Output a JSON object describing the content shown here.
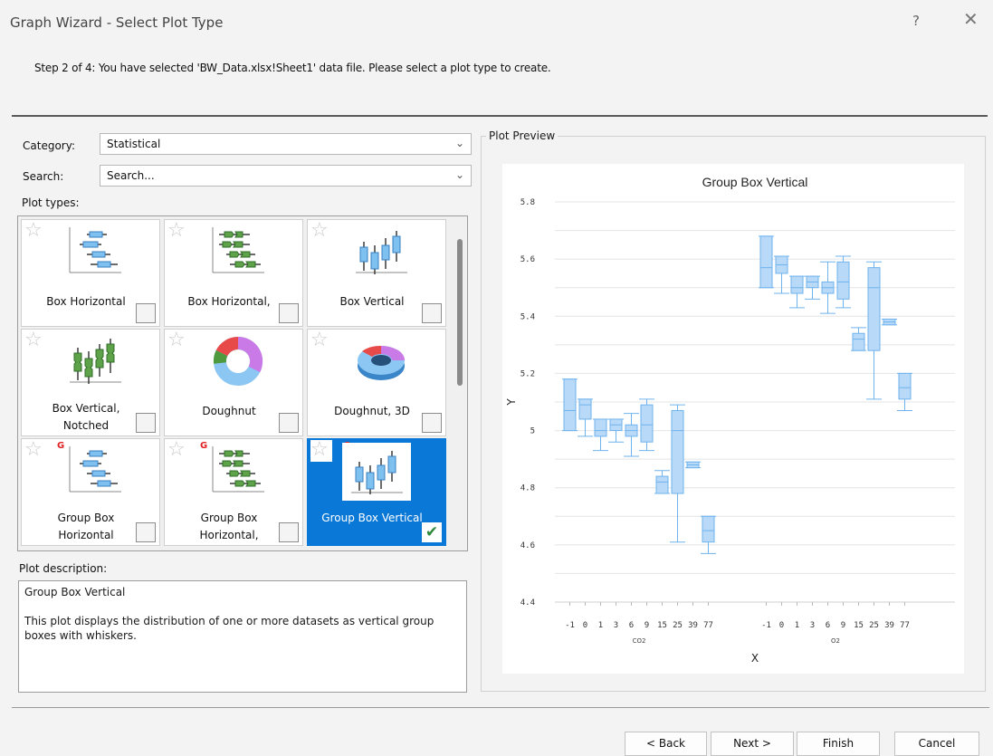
{
  "window": {
    "title": "Graph Wizard - Select Plot Type",
    "help_glyph": "?",
    "close_glyph": "✕"
  },
  "step_text": "Step 2 of 4:  You have selected 'BW_Data.xlsx!Sheet1' data file. Please select a plot type to create.",
  "category": {
    "label": "Category:",
    "value": "Statistical"
  },
  "search": {
    "label": "Search:",
    "placeholder": "Search..."
  },
  "plot_types_label": "Plot types:",
  "tiles": [
    {
      "label": "Box Horizontal",
      "icon": "box-horizontal-icon",
      "selected": false,
      "group": false
    },
    {
      "label": "Box Horizontal,",
      "icon": "box-horizontal-notched-icon",
      "selected": false,
      "group": false
    },
    {
      "label": "Box Vertical",
      "icon": "box-vertical-icon",
      "selected": false,
      "group": false
    },
    {
      "label": "Box Vertical, Notched",
      "icon": "box-vertical-notched-icon",
      "selected": false,
      "group": false
    },
    {
      "label": "Doughnut",
      "icon": "doughnut-icon",
      "selected": false,
      "group": false
    },
    {
      "label": "Doughnut, 3D",
      "icon": "doughnut-3d-icon",
      "selected": false,
      "group": false
    },
    {
      "label": "Group Box Horizontal",
      "icon": "group-box-horizontal-icon",
      "selected": false,
      "group": true
    },
    {
      "label": "Group Box Horizontal,",
      "icon": "group-box-horizontal-notched-icon",
      "selected": false,
      "group": true
    },
    {
      "label": "Group Box Vertical",
      "icon": "group-box-vertical-icon",
      "selected": true,
      "group": true
    }
  ],
  "group_badge": "G",
  "description": {
    "label": "Plot description:",
    "title": "Group Box Vertical",
    "body": "This plot displays the distribution of one or more datasets as vertical group boxes with whiskers."
  },
  "preview_label": "Plot Preview",
  "chart_data": {
    "type": "box",
    "title": "Group Box Vertical",
    "xlabel": "X",
    "ylabel": "Y",
    "ylim": [
      4.4,
      5.8
    ],
    "yticks": [
      "4.4",
      "4.6",
      "4.8",
      "5",
      "5.2",
      "5.4",
      "5.6",
      "5.8"
    ],
    "categories": [
      "-1",
      "0",
      "1",
      "3",
      "6",
      "9",
      "15",
      "25",
      "39",
      "77"
    ],
    "groups": [
      {
        "name": "CO2",
        "boxes": [
          {
            "min": 5.0,
            "q1": 5.0,
            "median": 5.07,
            "q3": 5.18,
            "max": 5.18
          },
          {
            "min": 4.98,
            "q1": 5.04,
            "median": 5.09,
            "q3": 5.11,
            "max": 5.11
          },
          {
            "min": 4.93,
            "q1": 4.98,
            "median": 5.0,
            "q3": 5.04,
            "max": 5.04
          },
          {
            "min": 4.96,
            "q1": 5.0,
            "median": 5.02,
            "q3": 5.04,
            "max": 5.04
          },
          {
            "min": 4.91,
            "q1": 4.98,
            "median": 5.0,
            "q3": 5.02,
            "max": 5.06
          },
          {
            "min": 4.93,
            "q1": 4.96,
            "median": 5.02,
            "q3": 5.09,
            "max": 5.11
          },
          {
            "min": 4.78,
            "q1": 4.78,
            "median": 4.82,
            "q3": 4.84,
            "max": 4.86
          },
          {
            "min": 4.61,
            "q1": 4.78,
            "median": 5.0,
            "q3": 5.07,
            "max": 5.09
          },
          {
            "min": 4.87,
            "q1": 4.87,
            "median": 4.88,
            "q3": 4.89,
            "max": 4.89
          },
          {
            "min": 4.57,
            "q1": 4.61,
            "median": 4.65,
            "q3": 4.7,
            "max": 4.7
          }
        ]
      },
      {
        "name": "O2",
        "boxes": [
          {
            "min": 5.5,
            "q1": 5.5,
            "median": 5.57,
            "q3": 5.68,
            "max": 5.68
          },
          {
            "min": 5.48,
            "q1": 5.55,
            "median": 5.58,
            "q3": 5.61,
            "max": 5.61
          },
          {
            "min": 5.43,
            "q1": 5.48,
            "median": 5.5,
            "q3": 5.54,
            "max": 5.54
          },
          {
            "min": 5.46,
            "q1": 5.5,
            "median": 5.52,
            "q3": 5.54,
            "max": 5.54
          },
          {
            "min": 5.41,
            "q1": 5.48,
            "median": 5.5,
            "q3": 5.52,
            "max": 5.59
          },
          {
            "min": 5.43,
            "q1": 5.46,
            "median": 5.52,
            "q3": 5.59,
            "max": 5.61
          },
          {
            "min": 5.28,
            "q1": 5.28,
            "median": 5.32,
            "q3": 5.34,
            "max": 5.36
          },
          {
            "min": 5.11,
            "q1": 5.28,
            "median": 5.5,
            "q3": 5.57,
            "max": 5.59
          },
          {
            "min": 5.37,
            "q1": 5.37,
            "median": 5.38,
            "q3": 5.39,
            "max": 5.39
          },
          {
            "min": 5.07,
            "q1": 5.11,
            "median": 5.15,
            "q3": 5.2,
            "max": 5.2
          }
        ]
      }
    ],
    "colors": {
      "box_fill": "#b8d9f7",
      "box_stroke": "#6fb3ee",
      "grid": "#e4e4e4"
    }
  },
  "buttons": {
    "back": "< Back",
    "next": "Next >",
    "finish": "Finish",
    "cancel": "Cancel"
  },
  "colors": {
    "accent": "#0a78d7",
    "check_green": "#2c8a3a"
  }
}
